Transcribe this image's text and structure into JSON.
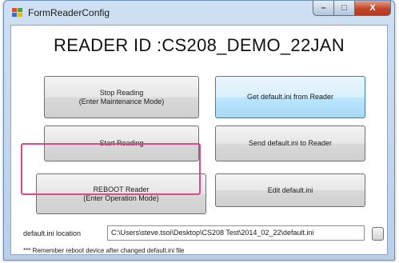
{
  "window": {
    "title": "FormReaderConfig",
    "controls": {
      "minimize": "–",
      "maximize": "□",
      "close": "X"
    }
  },
  "header": {
    "reader_id": "READER ID :CS208_DEMO_22JAN"
  },
  "buttons": {
    "stop_reading": {
      "line1": "Stop Reading",
      "line2": "(Enter Maintenance Mode)"
    },
    "get_default_ini": {
      "label": "Get default.ini from Reader"
    },
    "start_reading": {
      "label": "Start Reading"
    },
    "send_default_ini": {
      "label": "Send default.ini to Reader"
    },
    "reboot_reader": {
      "line1": "REBOOT Reader",
      "line2": "(Enter Operation Mode)"
    },
    "edit_default_ini": {
      "label": "Edit default.ini"
    }
  },
  "location": {
    "label": "default.ini location",
    "value": "C:\\Users\\steve.tsoi\\Desktop\\CS208 Test\\2014_02_22\\default.ini"
  },
  "note": "*** Remember reboot device after changed default.ini file",
  "colors": {
    "highlight": "#e0468a",
    "focus_button": "#bee6fd"
  },
  "icons": {
    "app": "app-icon-colored-squares",
    "browse": "browse-button"
  }
}
